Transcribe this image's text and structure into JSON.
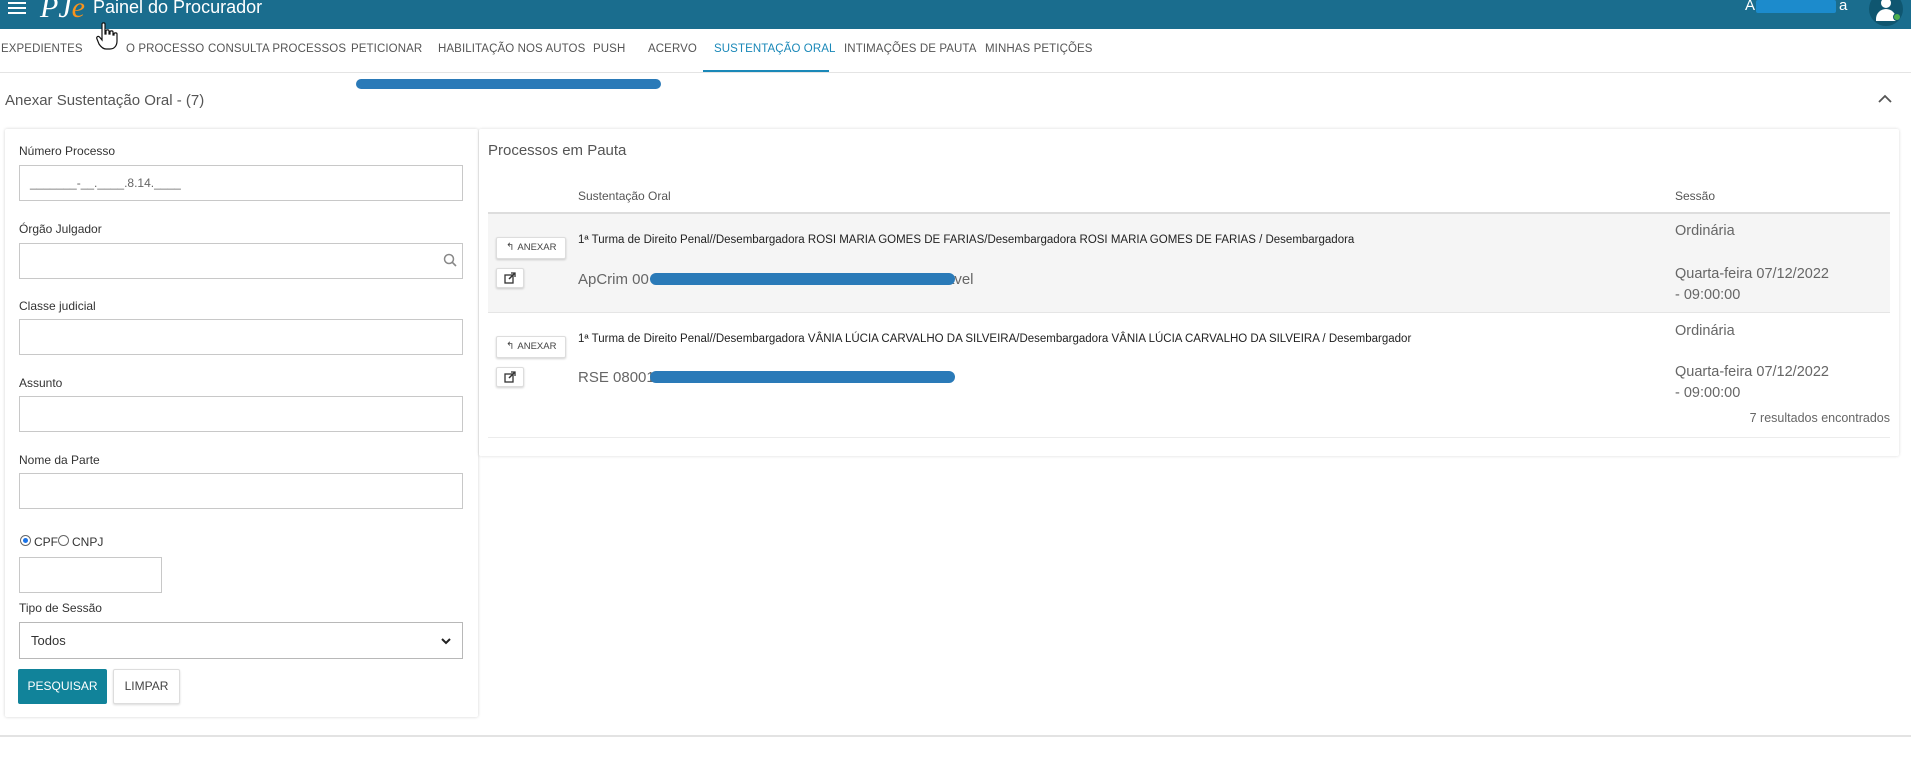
{
  "header": {
    "app_title": "Painel do Procurador",
    "user_initial": "A",
    "user_suffix": "a",
    "logo_p": "P",
    "logo_j": "J",
    "logo_e": "e"
  },
  "nav": {
    "items": [
      {
        "label": "EXPEDIENTES"
      },
      {
        "label": "O PROCESSO"
      },
      {
        "label": "CONSULTA PROCESSOS"
      },
      {
        "label": "PETICIONAR"
      },
      {
        "label": "HABILITAÇÃO NOS AUTOS"
      },
      {
        "label": "PUSH"
      },
      {
        "label": "ACERVO"
      },
      {
        "label": "SUSTENTAÇÃO ORAL"
      },
      {
        "label": "INTIMAÇÕES DE PAUTA"
      },
      {
        "label": "MINHAS PETIÇÕES"
      }
    ],
    "active": "SUSTENTAÇÃO ORAL"
  },
  "panel": {
    "title": "Anexar Sustentação Oral - (7)"
  },
  "filters": {
    "numero_processo": {
      "label": "Número Processo",
      "value": "_______-__.____.8.14.____"
    },
    "orgao_julgador": {
      "label": "Órgão Julgador",
      "value": ""
    },
    "classe_judicial": {
      "label": "Classe judicial",
      "value": ""
    },
    "assunto": {
      "label": "Assunto",
      "value": ""
    },
    "nome_parte": {
      "label": "Nome da Parte",
      "value": ""
    },
    "doc_type": {
      "cpf_label": "CPF",
      "cnpj_label": "CNPJ",
      "selected": "CPF"
    },
    "documento": {
      "value": ""
    },
    "tipo_sessao": {
      "label": "Tipo de Sessão",
      "selected": "Todos"
    },
    "search_button": "PESQUISAR",
    "clear_button": "LIMPAR"
  },
  "results": {
    "title": "Processos em Pauta",
    "columns": {
      "sustentacao": "Sustentação Oral",
      "sessao": "Sessão"
    },
    "anexar_label": "ANEXAR",
    "rows": [
      {
        "orgao": "1ª Turma de Direito Penal//Desembargadora ROSI MARIA GOMES DE FARIAS/Desembargadora ROSI MARIA GOMES DE FARIAS / Desembargadora",
        "processo_prefix": "ApCrim 00",
        "processo_suffix": "avel",
        "sessao_tipo": "Ordinária",
        "sessao_data": "Quarta-feira 07/12/2022",
        "sessao_hora": "- 09:00:00"
      },
      {
        "orgao": "1ª Turma de Direito Penal//Desembargadora VÂNIA LÚCIA CARVALHO DA SILVEIRA/Desembargadora VÂNIA LÚCIA CARVALHO DA SILVEIRA / Desembargador",
        "processo_prefix": "RSE 080010",
        "processo_suffix": "",
        "sessao_tipo": "Ordinária",
        "sessao_data": "Quarta-feira 07/12/2022",
        "sessao_hora": "- 09:00:00"
      }
    ],
    "count_text": "7 resultados encontrados"
  },
  "colors": {
    "header_bg": "#1a6d8e",
    "accent": "#1a88b8",
    "primary_button": "#11839a",
    "logo_accent": "#f7941d",
    "redaction": "#2a7ab8"
  }
}
